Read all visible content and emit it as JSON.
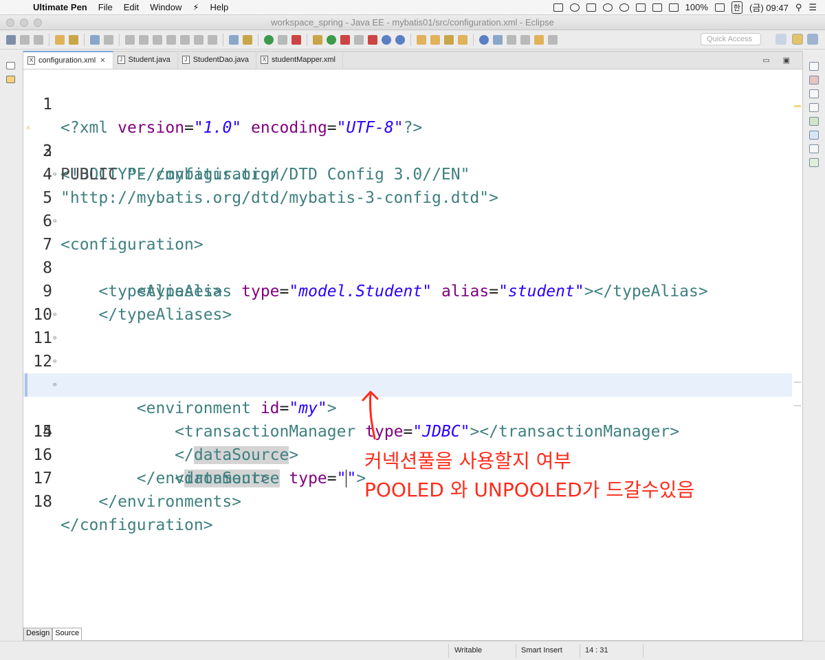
{
  "menubar": {
    "apple": "",
    "app": "Ultimate Pen",
    "items": [
      "File",
      "Edit",
      "Window",
      "Help"
    ],
    "battery": "100%",
    "ime": "한",
    "clock": "(금) 09:47"
  },
  "window": {
    "title": "workspace_spring - Java EE - mybatis01/src/configuration.xml - Eclipse"
  },
  "toolbar": {
    "quick_access_placeholder": "Quick Access"
  },
  "editor": {
    "tabs": [
      {
        "label": "configuration.xml",
        "icon": "X",
        "active": true
      },
      {
        "label": "Student.java",
        "icon": "J",
        "active": false
      },
      {
        "label": "StudentDao.java",
        "icon": "J",
        "active": false
      },
      {
        "label": "studentMapper.xml",
        "icon": "X",
        "active": false
      }
    ],
    "current_line": 14,
    "lines": [
      {
        "n": "1"
      },
      {
        "n": "2"
      },
      {
        "n": "3"
      },
      {
        "n": "4"
      },
      {
        "n": "5"
      },
      {
        "n": "6"
      },
      {
        "n": "7"
      },
      {
        "n": "8"
      },
      {
        "n": "9"
      },
      {
        "n": "10"
      },
      {
        "n": "11"
      },
      {
        "n": "12"
      },
      {
        "n": "13"
      },
      {
        "n": "14"
      },
      {
        "n": "15"
      },
      {
        "n": "16"
      },
      {
        "n": "17"
      },
      {
        "n": "18"
      }
    ],
    "bottom_tabs": [
      "Design",
      "Source"
    ]
  },
  "annotation": {
    "line1": "커넥션풀을 사용할지 여부",
    "line2": "POOLED 와 UNPOOLED가 드갈수있음",
    "color": "#ff2a1a"
  },
  "statusbar": {
    "mode": "Writable",
    "insert": "Smart Insert",
    "position": "14 : 31"
  },
  "colors": {
    "tag": "#3f7f7f",
    "attribute": "#7f007f",
    "string": "#2a00ff",
    "current_line": "#e8f0fb"
  }
}
